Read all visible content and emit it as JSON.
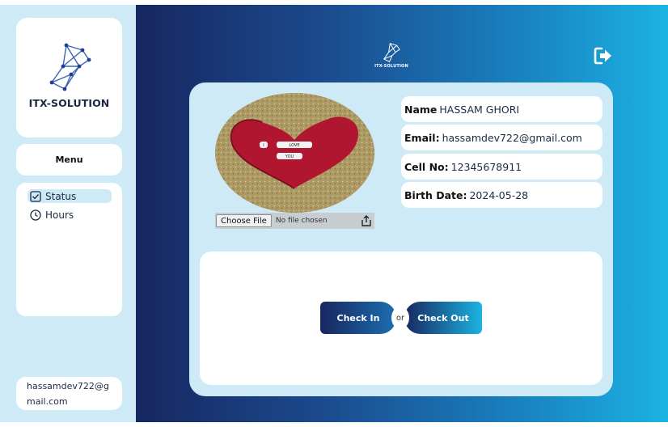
{
  "sidebar": {
    "logo_text": "ITX-SOLUTION",
    "menu_label": "Menu",
    "items": [
      {
        "label": "Status",
        "icon": "checkbox-icon",
        "active": true
      },
      {
        "label": "Hours",
        "icon": "clock-icon",
        "active": false
      }
    ],
    "user_email": "hassamdev722@gmail.com"
  },
  "header": {
    "logo_text": "ITX-SOLUTION",
    "logout_icon": "logout-icon"
  },
  "profile": {
    "photo_caption_words": [
      "I",
      "LOVE",
      "YOU"
    ],
    "file_input": {
      "button_label": "Choose File",
      "status_text": "No file chosen",
      "icon": "share-icon"
    },
    "fields": [
      {
        "label": "Name",
        "value": "HASSAM GHORI"
      },
      {
        "label": "Email:",
        "value": "hassamdev722@gmail.com"
      },
      {
        "label": "Cell No:",
        "value": "12345678911"
      },
      {
        "label": "Birth Date:",
        "value": "2024-05-28"
      }
    ]
  },
  "actions": {
    "check_in_label": "Check In",
    "or_label": "or",
    "check_out_label": "Check Out"
  },
  "colors": {
    "accent_dark": "#172760",
    "accent_light": "#1bb3e2",
    "panel_bg": "#cfeaf7",
    "heart": "#b0162f"
  }
}
